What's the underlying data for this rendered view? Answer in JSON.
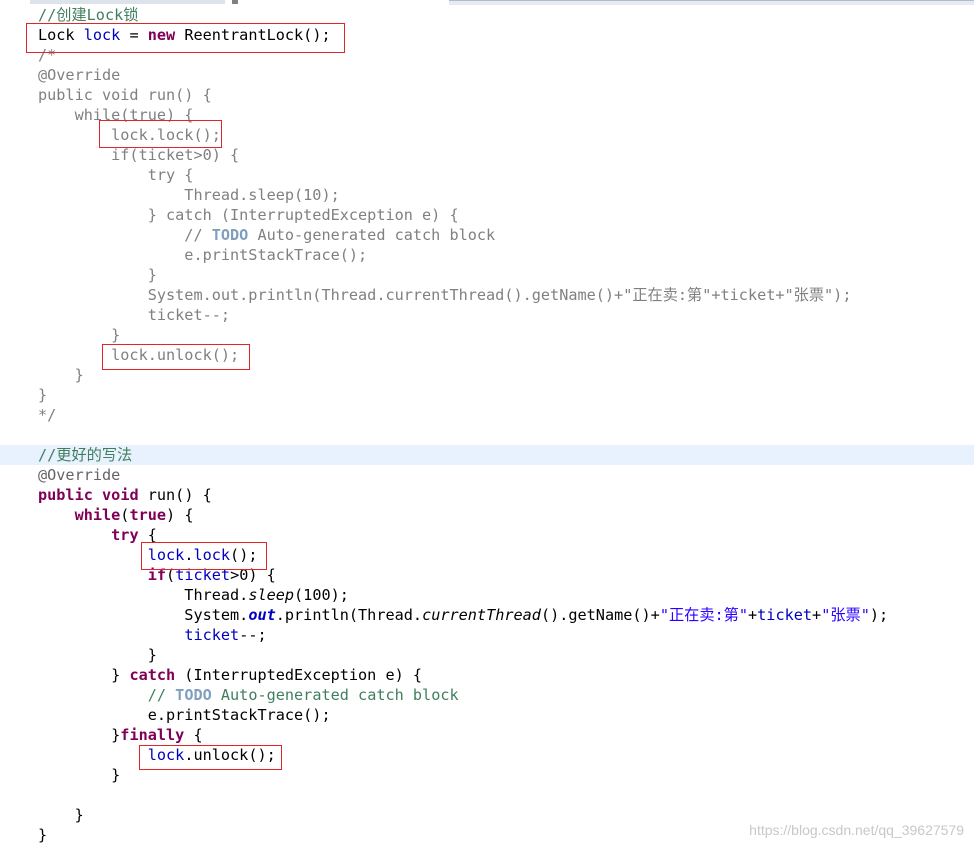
{
  "editor": {
    "language": "java",
    "colors": {
      "comment": "#3f7f5f",
      "keyword": "#7f0055",
      "field": "#0000c0",
      "string": "#2a00ff",
      "todo_tag": "#7f9fbf",
      "highlight_box": "#e0252b",
      "current_line": "#e8f2fe"
    },
    "lines": [
      "//创建Lock锁",
      "Lock lock = new ReentrantLock();",
      "/*",
      "@Override",
      "public void run() {",
      "    while(true) {",
      "        lock.lock();",
      "        if(ticket>0) {",
      "            try {",
      "                Thread.sleep(10);",
      "            } catch (InterruptedException e) {",
      "                // TODO Auto-generated catch block",
      "                e.printStackTrace();",
      "            }",
      "            System.out.println(Thread.currentThread().getName()+\"正在卖:第\"+ticket+\"张票\");",
      "            ticket--;",
      "        }",
      "        lock.unlock();",
      "    }",
      "}",
      "*/",
      "",
      "//更好的写法",
      "@Override",
      "public void run() {",
      "    while(true) {",
      "        try {",
      "            lock.lock();",
      "            if(ticket>0) {",
      "                Thread.sleep(100);",
      "                System.out.println(Thread.currentThread().getName()+\"正在卖:第\"+ticket+\"张票\");",
      "                ticket--;",
      "            }",
      "        } catch (InterruptedException e) {",
      "            // TODO Auto-generated catch block",
      "            e.printStackTrace();",
      "        }finally {",
      "            lock.unlock();",
      "        }",
      "",
      "    }",
      "}"
    ]
  },
  "watermark": "https://blog.csdn.net/qq_39627579"
}
